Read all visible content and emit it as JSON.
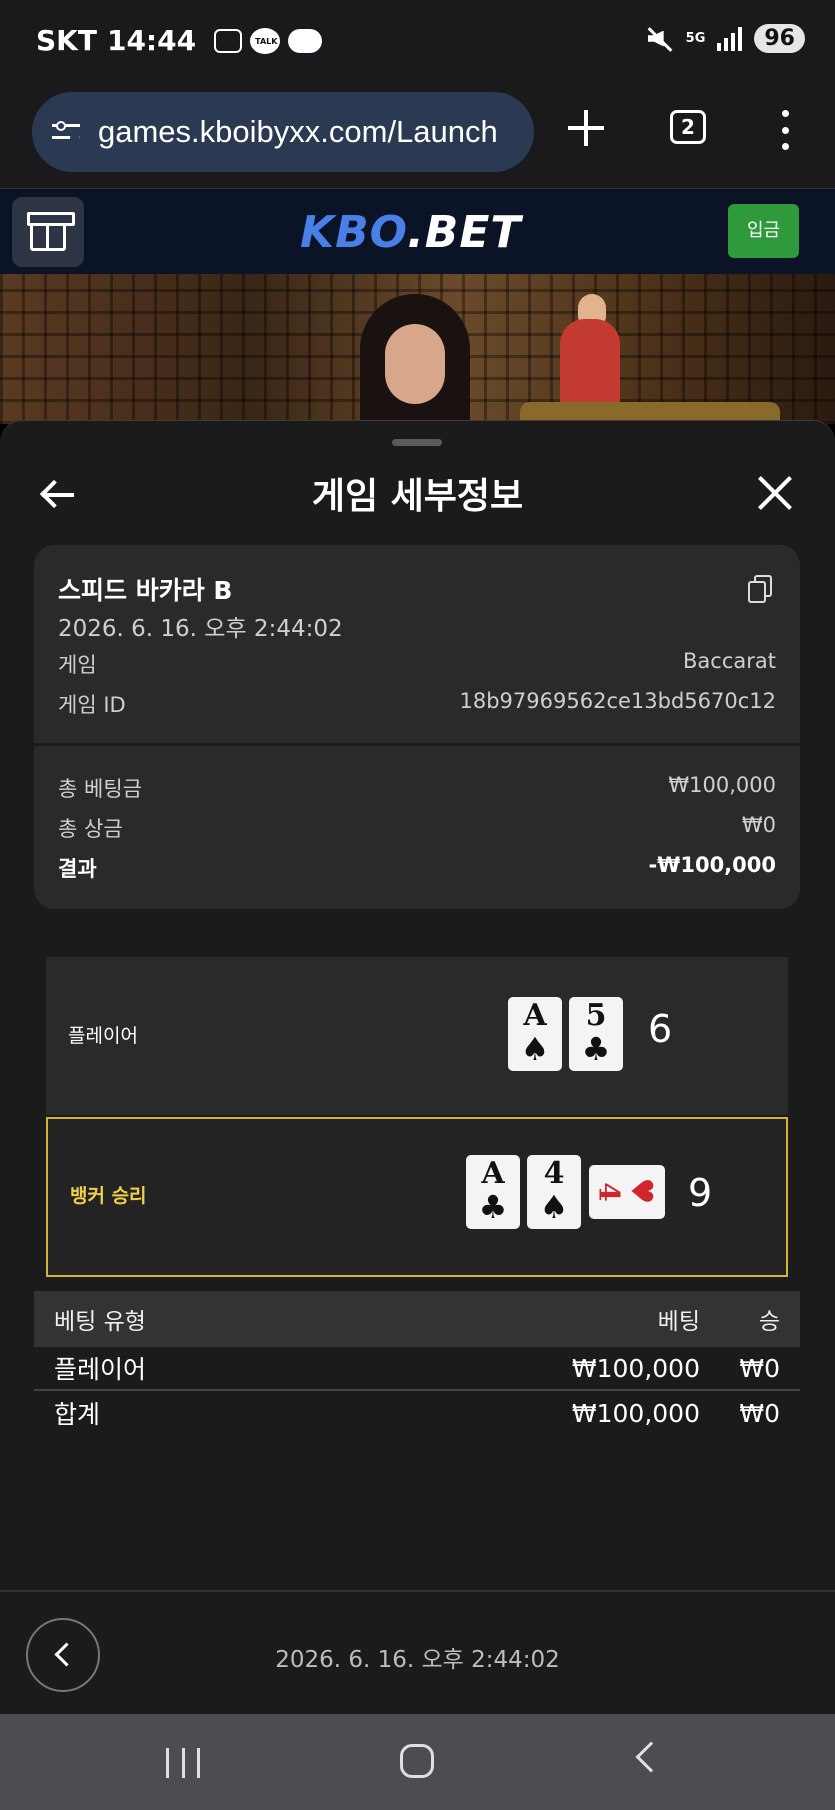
{
  "status_bar": {
    "carrier": "SKT",
    "time": "14:44",
    "network": "5G",
    "battery": "96"
  },
  "browser": {
    "url": "games.kboibyxx.com/Launch",
    "tab_count": "2"
  },
  "site": {
    "logo_part1": "KBO",
    "logo_part2": ".BET",
    "deposit_label": "입금",
    "colors": {
      "header_bg": "#0b1326",
      "logo_blue": "#4a7fe8",
      "deposit_green": "#2f9a3c"
    }
  },
  "panel": {
    "title": "게임 세부정보",
    "game_name": "스피드 바카라 B",
    "date": "2026. 6. 16. 오후 2:44:02",
    "details": [
      {
        "label": "게임",
        "value": "Baccarat"
      },
      {
        "label": "게임 ID",
        "value": "18b97969562ce13bd5670c12"
      }
    ],
    "totals": [
      {
        "label": "총 베팅금",
        "value": "₩100,000"
      },
      {
        "label": "총 상금",
        "value": "₩0"
      },
      {
        "label": "결과",
        "value": "-₩100,000"
      }
    ]
  },
  "hands": {
    "player": {
      "label": "플레이어",
      "score": "6",
      "cards": [
        {
          "rank": "A",
          "suit": "♠"
        },
        {
          "rank": "5",
          "suit": "♣"
        }
      ]
    },
    "banker": {
      "label": "뱅커 승리",
      "score": "9",
      "cards": [
        {
          "rank": "A",
          "suit": "♣"
        },
        {
          "rank": "4",
          "suit": "♠"
        },
        {
          "rank": "4",
          "suit": "♥"
        }
      ],
      "highlight_color": "#d4b33a"
    }
  },
  "bets": {
    "headers": [
      "베팅 유형",
      "베팅",
      "승"
    ],
    "rows": [
      {
        "type": "플레이어",
        "bet": "₩100,000",
        "win": "₩0"
      }
    ],
    "total": {
      "type": "합계",
      "bet": "₩100,000",
      "win": "₩0"
    }
  },
  "footer": {
    "date": "2026. 6. 16. 오후 2:44:02"
  }
}
